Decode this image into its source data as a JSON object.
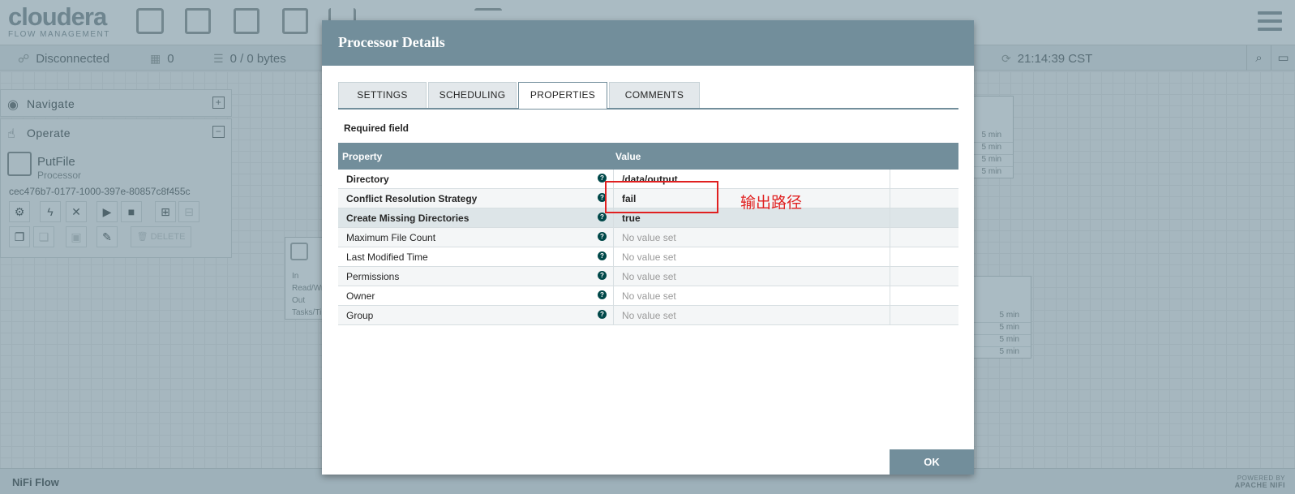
{
  "app": {
    "logo": "cloudera",
    "logo_sub": "FLOW MANAGEMENT"
  },
  "status_bar": {
    "connection": "Disconnected",
    "active_threads": "0",
    "queued": "0 / 0 bytes",
    "last_refreshed": "21:14:39 CST"
  },
  "palette": {
    "navigate_title": "Navigate",
    "operate_title": "Operate",
    "processor_name": "PutFile",
    "processor_type": "Processor",
    "processor_id": "cec476b7-0177-1000-397e-80857c8f455c",
    "delete_label": "DELETE"
  },
  "background_processor": {
    "rows": [
      "In",
      "Read/Wr",
      "Out",
      "Tasks/Ti"
    ],
    "stats_top": [
      "5 min",
      "5 min",
      "5 min",
      "5 min"
    ],
    "stats_bottom": [
      "5 min",
      "5 min",
      "5 min",
      "5 min"
    ]
  },
  "dialog": {
    "title": "Processor Details",
    "tabs": [
      "SETTINGS",
      "SCHEDULING",
      "PROPERTIES",
      "COMMENTS"
    ],
    "active_tab": "PROPERTIES",
    "required_label": "Required field",
    "columns": [
      "Property",
      "Value"
    ],
    "properties": [
      {
        "name": "Directory",
        "value": "/data/output",
        "required": true
      },
      {
        "name": "Conflict Resolution Strategy",
        "value": "fail",
        "required": true
      },
      {
        "name": "Create Missing Directories",
        "value": "true",
        "required": true
      },
      {
        "name": "Maximum File Count",
        "value": "No value set",
        "required": false
      },
      {
        "name": "Last Modified Time",
        "value": "No value set",
        "required": false
      },
      {
        "name": "Permissions",
        "value": "No value set",
        "required": false
      },
      {
        "name": "Owner",
        "value": "No value set",
        "required": false
      },
      {
        "name": "Group",
        "value": "No value set",
        "required": false
      }
    ],
    "ok_label": "OK"
  },
  "annotation": {
    "text": "输出路径",
    "color": "#e02020"
  },
  "footer": {
    "breadcrumb": "NiFi Flow",
    "powered_by": "POWERED BY",
    "powered_brand": "APACHE NIFI"
  },
  "colors": {
    "dialog_header": "#728e9b",
    "help_icon": "#004849"
  }
}
